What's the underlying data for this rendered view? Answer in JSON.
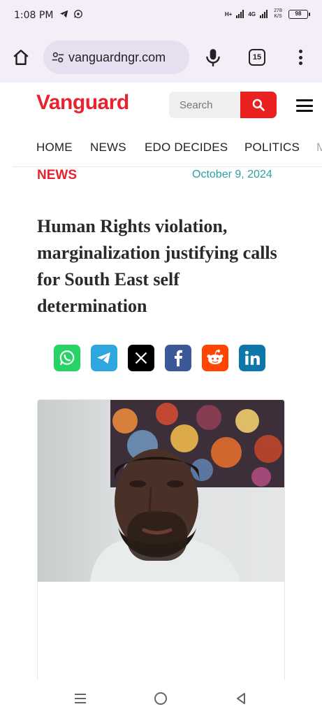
{
  "status_bar": {
    "time": "1:08 PM",
    "battery": "98",
    "net_speed": "278 K/S",
    "net1": "H+",
    "net2": "4G"
  },
  "browser": {
    "url": "vanguardngr.com",
    "tab_count": "15"
  },
  "site": {
    "logo": "Vanguard",
    "search_placeholder": "Search",
    "nav": [
      "HOME",
      "NEWS",
      "EDO DECIDES",
      "POLITICS",
      "M"
    ]
  },
  "article": {
    "category": "NEWS",
    "date": "October 9, 2024",
    "headline": "Human Rights violation, marginalization justifying calls for South East self determination"
  },
  "share": {
    "buttons": [
      {
        "icon": "whatsapp-icon",
        "color": "#25d366"
      },
      {
        "icon": "telegram-icon",
        "color": "#2ea7e0"
      },
      {
        "icon": "x-icon",
        "color": "#000000"
      },
      {
        "icon": "facebook-icon",
        "color": "#3b5998"
      },
      {
        "icon": "reddit-icon",
        "color": "#ff4500"
      },
      {
        "icon": "linkedin-icon",
        "color": "#0e76a8"
      }
    ]
  },
  "colors": {
    "brand_red": "#e8232f",
    "date_teal": "#2aa0a6",
    "chrome_bg": "#f3eef8"
  }
}
